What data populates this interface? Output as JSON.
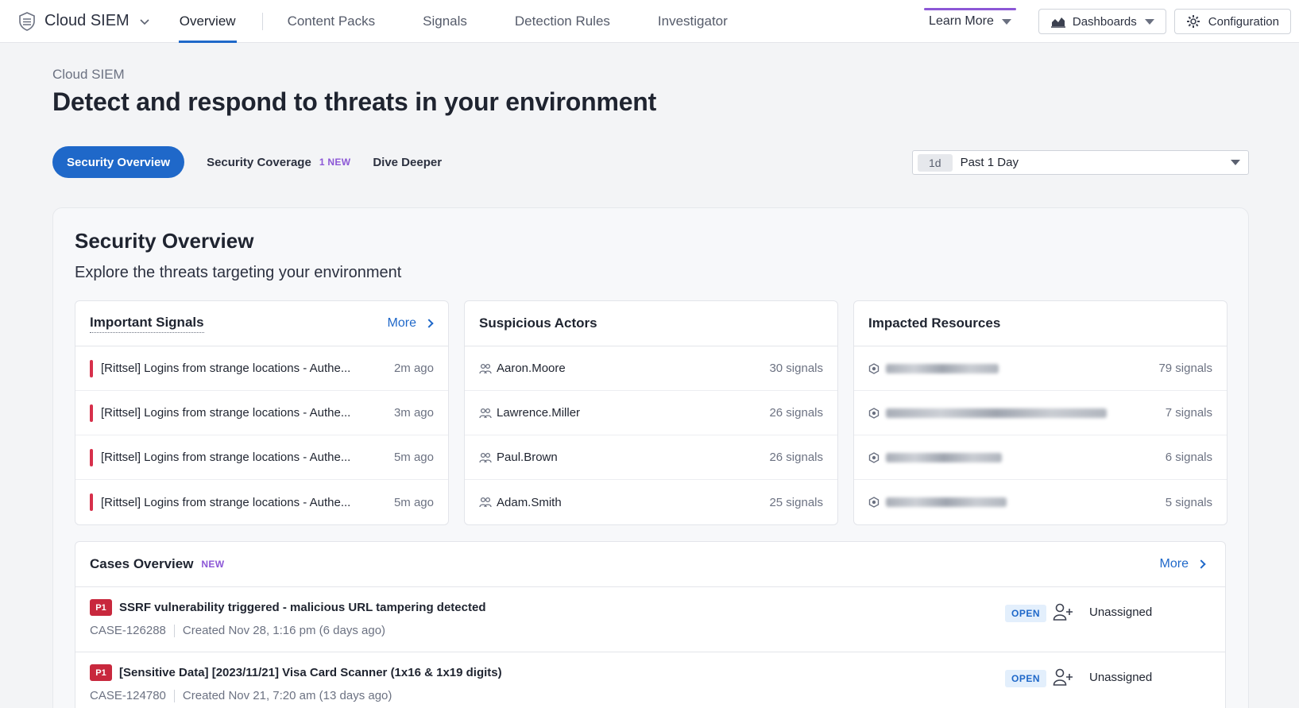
{
  "app": {
    "title": "Cloud SIEM",
    "nav_tabs": [
      {
        "label": "Overview",
        "active": true
      },
      {
        "label": "Content Packs",
        "active": false
      },
      {
        "label": "Signals",
        "active": false
      },
      {
        "label": "Detection Rules",
        "active": false
      },
      {
        "label": "Investigator",
        "active": false
      }
    ],
    "learn_more": "Learn More",
    "dashboards": "Dashboards",
    "configuration": "Configuration",
    "accent_color": "#1f68c9",
    "highlight_color": "#8c57d6"
  },
  "header": {
    "breadcrumb": "Cloud SIEM",
    "title": "Detect and respond to threats in your environment"
  },
  "subtabs": {
    "security_overview": "Security Overview",
    "security_coverage": "Security Coverage",
    "coverage_badge": "1 NEW",
    "dive_deeper": "Dive Deeper"
  },
  "time_picker": {
    "chip": "1d",
    "label": "Past 1 Day"
  },
  "overview": {
    "title": "Security Overview",
    "subtitle": "Explore the threats targeting your environment"
  },
  "important_signals": {
    "title": "Important Signals",
    "more": "More",
    "severity_color": "#d7304b",
    "rows": [
      {
        "text": "[Rittsel] Logins from strange locations - Authe...",
        "time": "2m ago"
      },
      {
        "text": "[Rittsel] Logins from strange locations - Authe...",
        "time": "3m ago"
      },
      {
        "text": "[Rittsel] Logins from strange locations - Authe...",
        "time": "5m ago"
      },
      {
        "text": "[Rittsel] Logins from strange locations - Authe...",
        "time": "5m ago"
      }
    ]
  },
  "suspicious_actors": {
    "title": "Suspicious Actors",
    "rows": [
      {
        "name": "Aaron.Moore",
        "count": "30 signals"
      },
      {
        "name": "Lawrence.Miller",
        "count": "26 signals"
      },
      {
        "name": "Paul.Brown",
        "count": "26 signals"
      },
      {
        "name": "Adam.Smith",
        "count": "25 signals"
      }
    ]
  },
  "impacted_resources": {
    "title": "Impacted Resources",
    "rows": [
      {
        "count": "79 signals"
      },
      {
        "count": "7 signals"
      },
      {
        "count": "6 signals"
      },
      {
        "count": "5 signals"
      }
    ]
  },
  "cases": {
    "title": "Cases Overview",
    "badge": "NEW",
    "more": "More",
    "rows": [
      {
        "priority": "P1",
        "title": "SSRF vulnerability triggered - malicious URL tampering detected",
        "id": "CASE-126288",
        "created": "Created Nov 28, 1:16 pm (6 days ago)",
        "status": "OPEN",
        "assignee": "Unassigned"
      },
      {
        "priority": "P1",
        "title": "[Sensitive Data] [2023/11/21] Visa Card Scanner (1x16 & 1x19 digits)",
        "id": "CASE-124780",
        "created": "Created Nov 21, 7:20 am (13 days ago)",
        "status": "OPEN",
        "assignee": "Unassigned"
      }
    ]
  }
}
